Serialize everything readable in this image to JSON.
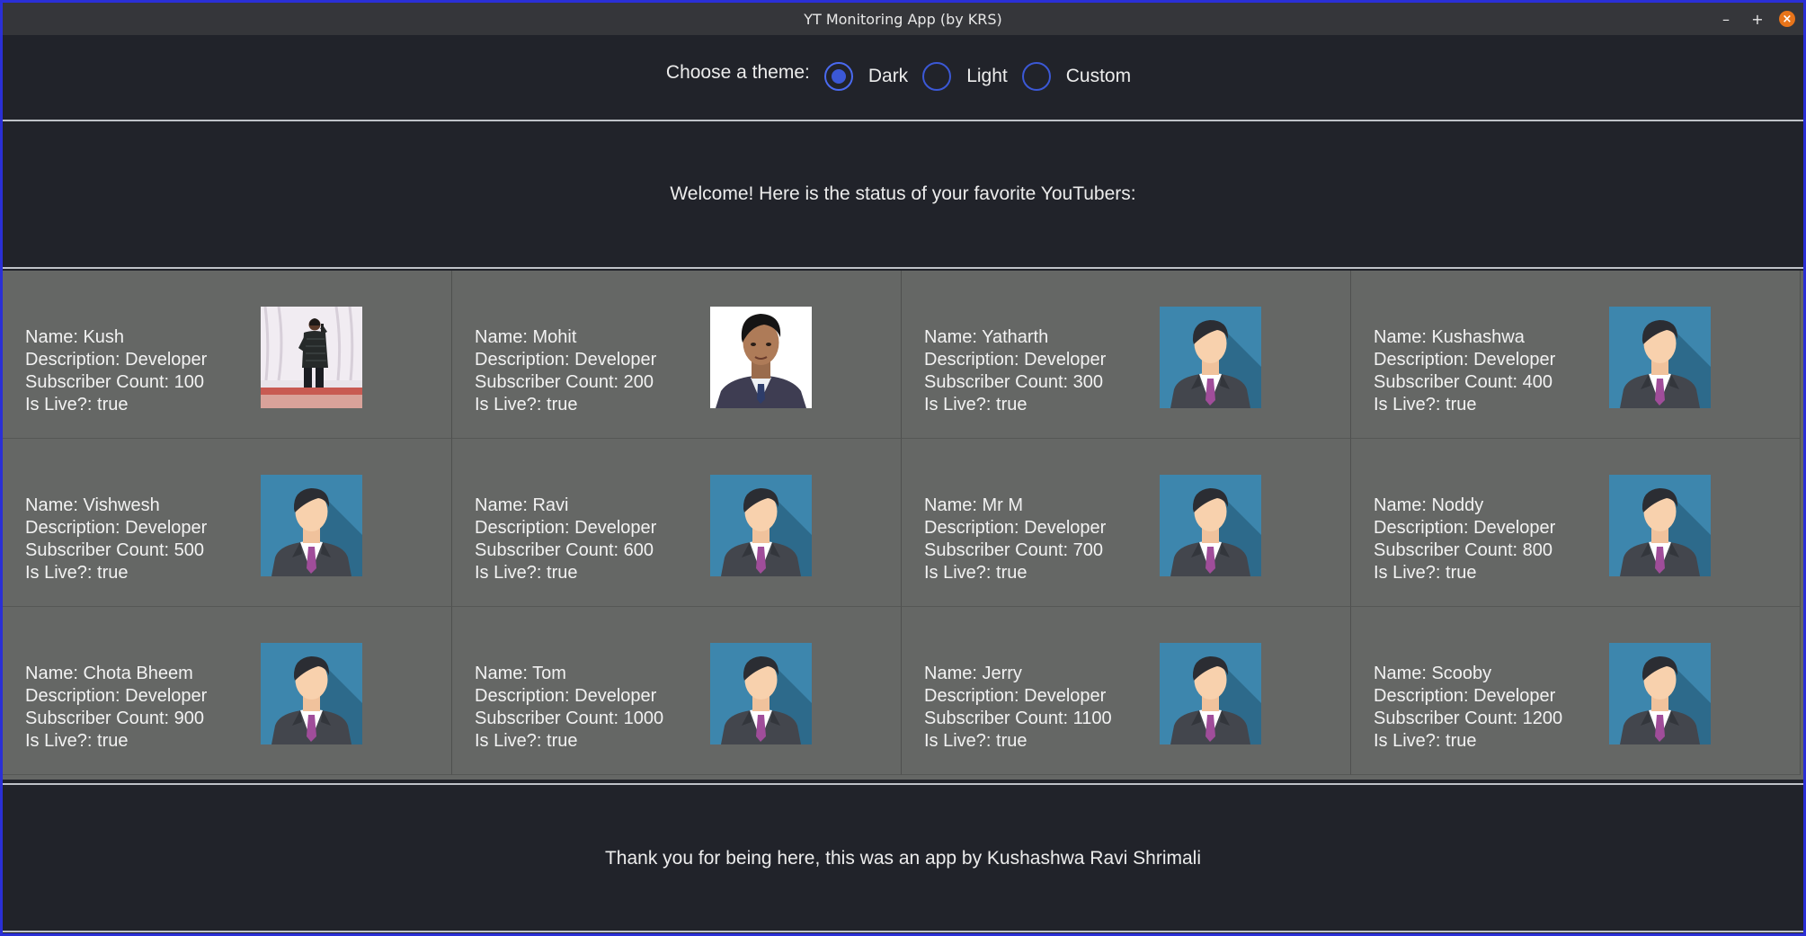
{
  "window": {
    "title": "YT Monitoring App (by KRS)",
    "controls": {
      "minimize": "–",
      "maximize": "+",
      "close": "×"
    }
  },
  "theme": {
    "label": "Choose a theme:",
    "options": [
      "Dark",
      "Light",
      "Custom"
    ],
    "selected": "Dark"
  },
  "welcome": "Welcome! Here is the status of your favorite YouTubers:",
  "youtubers": [
    {
      "name": "Name: Kush",
      "desc": "Description: Developer",
      "subs": "Subscriber Count: 100",
      "live": "Is Live?: true",
      "avatar": "photo-man-stage"
    },
    {
      "name": "Name: Mohit",
      "desc": "Description: Developer",
      "subs": "Subscriber Count: 200",
      "live": "Is Live?: true",
      "avatar": "photo-man-portrait"
    },
    {
      "name": "Name: Yatharth",
      "desc": "Description: Developer",
      "subs": "Subscriber Count: 300",
      "live": "Is Live?: true",
      "avatar": "default-avatar"
    },
    {
      "name": "Name: Kushashwa",
      "desc": "Description: Developer",
      "subs": "Subscriber Count: 400",
      "live": "Is Live?: true",
      "avatar": "default-avatar"
    },
    {
      "name": "Name: Vishwesh",
      "desc": "Description: Developer",
      "subs": "Subscriber Count: 500",
      "live": "Is Live?: true",
      "avatar": "default-avatar"
    },
    {
      "name": "Name: Ravi",
      "desc": "Description: Developer",
      "subs": "Subscriber Count: 600",
      "live": "Is Live?: true",
      "avatar": "default-avatar"
    },
    {
      "name": "Name: Mr M",
      "desc": "Description: Developer",
      "subs": "Subscriber Count: 700",
      "live": "Is Live?: true",
      "avatar": "default-avatar"
    },
    {
      "name": "Name: Noddy",
      "desc": "Description: Developer",
      "subs": "Subscriber Count: 800",
      "live": "Is Live?: true",
      "avatar": "default-avatar"
    },
    {
      "name": "Name: Chota Bheem",
      "desc": "Description: Developer",
      "subs": "Subscriber Count: 900",
      "live": "Is Live?: true",
      "avatar": "default-avatar"
    },
    {
      "name": "Name: Tom",
      "desc": "Description: Developer",
      "subs": "Subscriber Count: 1000",
      "live": "Is Live?: true",
      "avatar": "default-avatar"
    },
    {
      "name": "Name: Jerry",
      "desc": "Description: Developer",
      "subs": "Subscriber Count: 1100",
      "live": "Is Live?: true",
      "avatar": "default-avatar"
    },
    {
      "name": "Name: Scooby",
      "desc": "Description: Developer",
      "subs": "Subscriber Count: 1200",
      "live": "Is Live?: true",
      "avatar": "default-avatar"
    }
  ],
  "footer": "Thank you for being here, this was an app by Kushashwa Ravi Shrimali",
  "colors": {
    "background": "#21232a",
    "card_background": "#656765",
    "accent": "#3b58d6",
    "window_border": "#2a2fd6",
    "close_button": "#e8741a"
  }
}
